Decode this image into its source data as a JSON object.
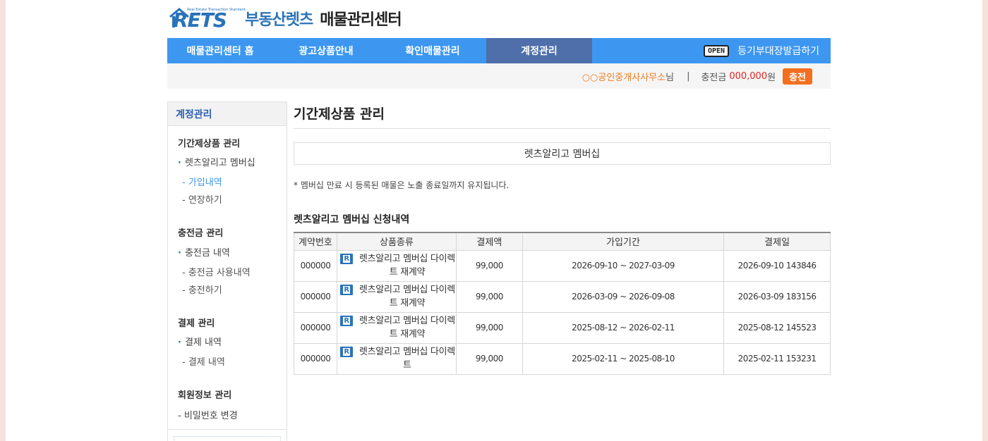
{
  "logo": {
    "brand": "RETS",
    "tagline": "Real Estate Transaction Standard",
    "name": "부동산렛츠",
    "sub": "매물관리센터"
  },
  "gnb": {
    "items": [
      {
        "label": "매물관리센터 홈"
      },
      {
        "label": "광고상품안내"
      },
      {
        "label": "확인매물관리"
      },
      {
        "label": "계정관리"
      }
    ],
    "open_badge": "OPEN",
    "right_label": "등기부대장발급하기"
  },
  "subbar": {
    "office": "○○공인중개사사무소",
    "office_suffix": "님",
    "separator": "|",
    "charge_label": "충전금",
    "charge_amount": "000,000",
    "charge_unit": "원",
    "charge_button": "충전"
  },
  "sidebar": {
    "title": "계정관리",
    "groups": [
      {
        "label": "기간제상품 관리",
        "sub": "렛츠알리고 멤버십",
        "items": [
          "- 가입내역",
          "- 연장하기"
        ]
      },
      {
        "label": "충전금 관리",
        "sub": "충전금 내역",
        "items": [
          "- 충전금 사용내역",
          "- 충전하기"
        ]
      },
      {
        "label": "결제 관리",
        "sub": "결제 내역",
        "items": [
          "- 결제 내역"
        ]
      },
      {
        "label": "회원정보 관리",
        "items": [
          "- 비밀번호 변경"
        ]
      }
    ]
  },
  "content": {
    "title": "기간제상품 관리",
    "tab": "렛츠알리고 멤버십",
    "note": "* 멤버십 만료 시 등록된 매물은 노출 종료일까지 유지됩니다.",
    "subheading": "렛츠알리고 멤버십 신청내역",
    "table": {
      "headers": [
        "계약번호",
        "상품종류",
        "결제액",
        "가입기간",
        "결제일"
      ],
      "rows": [
        {
          "no": "000000",
          "product": "렛츠알리고 멤버십 다이렉트 재계약",
          "amount": "99,000",
          "period": "2026-09-10 ~ 2027-03-09",
          "paid": "2026-09-10 143846"
        },
        {
          "no": "000000",
          "product": "렛츠알리고 멤버십 다이렉트 재계약",
          "amount": "99,000",
          "period": "2026-03-09 ~ 2026-09-08",
          "paid": "2026-03-09 183156"
        },
        {
          "no": "000000",
          "product": "렛츠알리고 멤버십 다이렉트 재계약",
          "amount": "99,000",
          "period": "2025-08-12 ~ 2026-02-11",
          "paid": "2025-08-12 145523"
        },
        {
          "no": "000000",
          "product": "렛츠알리고 멤버십 다이렉트",
          "amount": "99,000",
          "period": "2025-02-11 ~ 2025-08-10",
          "paid": "2025-02-11 153231"
        }
      ]
    }
  },
  "colors": {
    "accent": "#3d97f0",
    "active_tab": "#4e6fa9",
    "brand": "#2a73b8",
    "office": "#ee7d22",
    "money": "#e0231f",
    "charge_button": "#f36f1f"
  },
  "icons": {
    "logo_house": "house-icon",
    "product": "rets-r-icon"
  }
}
